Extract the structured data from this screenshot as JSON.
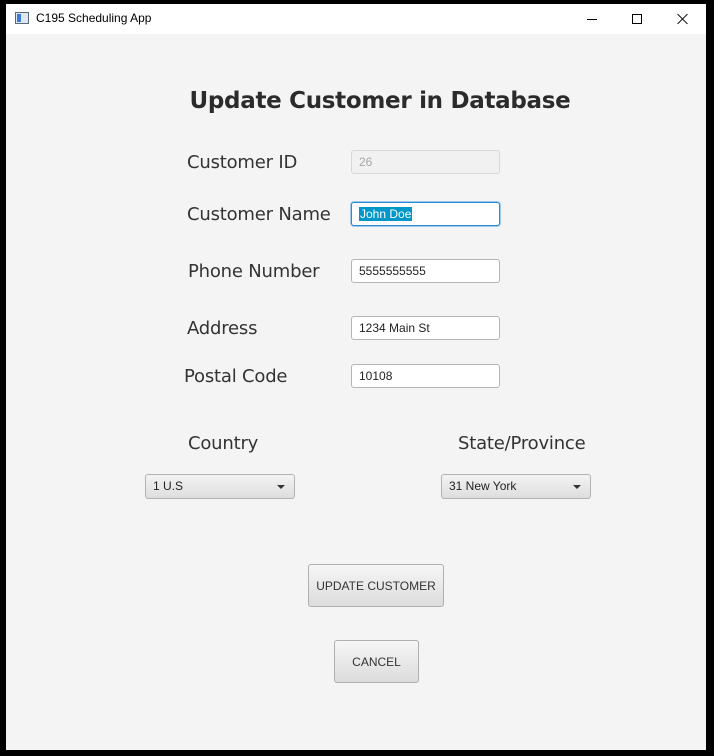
{
  "window": {
    "title": "C195 Scheduling App",
    "controls": {
      "minimize": "minimize",
      "maximize": "maximize",
      "close": "close"
    }
  },
  "form": {
    "heading": "Update Customer in Database",
    "customer_id": {
      "label": "Customer ID",
      "value": "26",
      "disabled": true
    },
    "customer_name": {
      "label": "Customer Name",
      "value": "John Doe",
      "focused": true,
      "selected": true
    },
    "phone_number": {
      "label": "Phone Number",
      "value": "5555555555"
    },
    "address": {
      "label": "Address",
      "value": "1234 Main St"
    },
    "postal_code": {
      "label": "Postal Code",
      "value": "10108"
    },
    "country": {
      "label": "Country",
      "selected": "1 U.S"
    },
    "state_province": {
      "label": "State/Province",
      "selected": "31 New York"
    }
  },
  "buttons": {
    "update": "UPDATE CUSTOMER",
    "cancel": "CANCEL"
  },
  "colors": {
    "window_bg": "#f4f4f4",
    "focus_border": "#2a8ad4",
    "selection_bg": "#0096c9"
  }
}
